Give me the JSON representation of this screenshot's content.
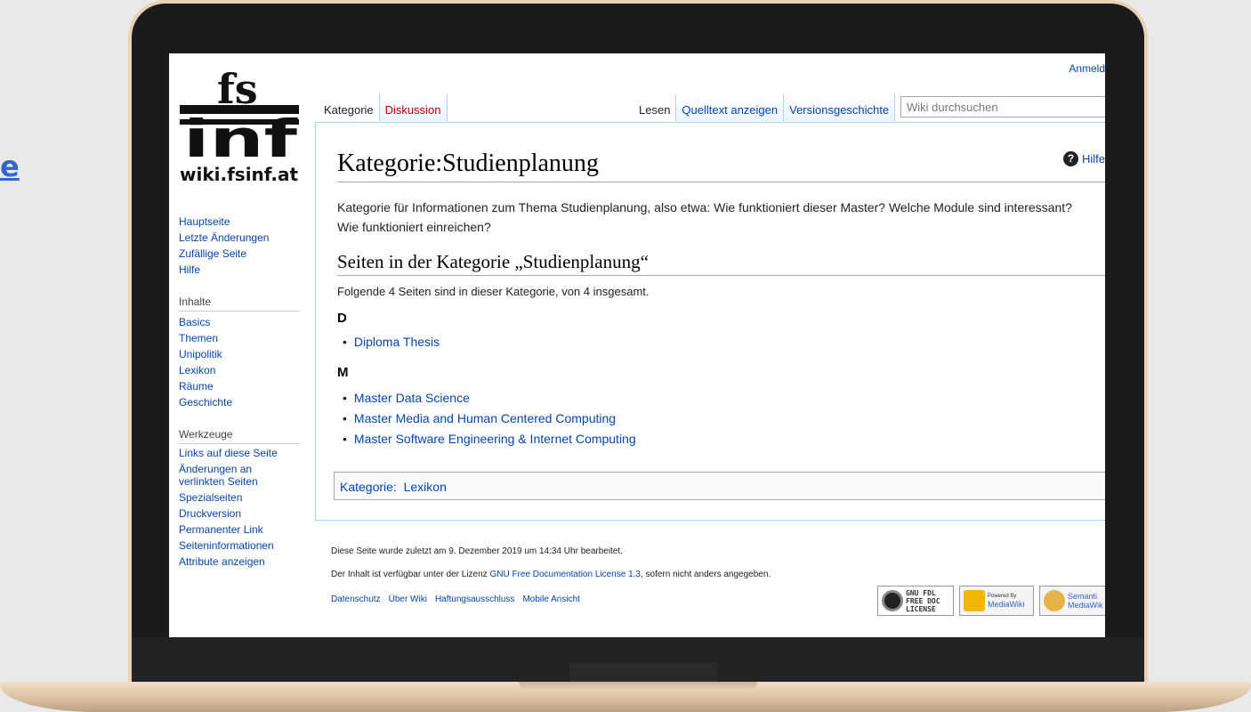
{
  "background": {
    "edge_text": "e"
  },
  "wiki": {
    "logo": {
      "top_text": "fs",
      "main_text": "inf",
      "site": "wiki.fsinf.at"
    },
    "user_link": "Anmeld",
    "tabs_left": [
      {
        "label": "Kategorie",
        "kind": "selected"
      },
      {
        "label": "Diskussion",
        "kind": "diskussion"
      }
    ],
    "tabs_right": [
      {
        "label": "Lesen",
        "kind": "selected"
      },
      {
        "label": "Quelltext anzeigen",
        "kind": "link"
      },
      {
        "label": "Versionsgeschichte",
        "kind": "link"
      }
    ],
    "search": {
      "placeholder": "Wiki durchsuchen"
    },
    "help": "Hilfe",
    "title": "Kategorie:Studienplanung",
    "intro": "Kategorie für Informationen zum Thema Studienplanung, also etwa: Wie funktioniert dieser Master? Welche Module sind interessant? Wie funktioniert einreichen?",
    "section_title": "Seiten in der Kategorie „Studienplanung“",
    "count_text": "Folgende 4 Seiten sind in dieser Kategorie, von 4 insgesamt.",
    "groups": [
      {
        "letter": "D",
        "pages": [
          "Diploma Thesis"
        ]
      },
      {
        "letter": "M",
        "pages": [
          "Master Data Science",
          "Master Media and Human Centered Computing",
          "Master Software Engineering & Internet Computing"
        ]
      }
    ],
    "catlinks": {
      "label": "Kategorie:",
      "link": "Lexikon"
    },
    "sidebar": {
      "nav": [
        "Hauptseite",
        "Letzte Änderungen",
        "Zufällige Seite",
        "Hilfe"
      ],
      "inhalte_title": "Inhalte",
      "inhalte": [
        "Basics",
        "Themen",
        "Unipolitik",
        "Lexikon",
        "Räume",
        "Geschichte"
      ],
      "werkzeuge_title": "Werkzeuge",
      "werkzeuge": [
        "Links auf diese Seite",
        "Änderungen an verlinkten Seiten",
        "Spezialseiten",
        "Druckversion",
        "Permanenter Link",
        "Seiteninformationen",
        "Attribute anzeigen"
      ]
    },
    "footer": {
      "last_edit": "Diese Seite wurde zuletzt am 9. Dezember 2019 um 14:34 Uhr bearbeitet.",
      "license_pre": "Der Inhalt ist verfügbar unter der Lizenz ",
      "license_link": "GNU Free Documentation License 1.3",
      "license_post": ", sofern nicht anders angegeben.",
      "links": [
        "Datenschutz",
        "Über Wiki",
        "Haftungsausschluss",
        "Mobile Ansicht"
      ],
      "badges": {
        "gnu": [
          "GNU FDL",
          "FREE DOC",
          "LICENSE"
        ],
        "mediawiki": [
          "Powered By",
          "MediaWiki"
        ],
        "semantic": [
          "Semanti",
          "MediaWik"
        ]
      }
    }
  }
}
